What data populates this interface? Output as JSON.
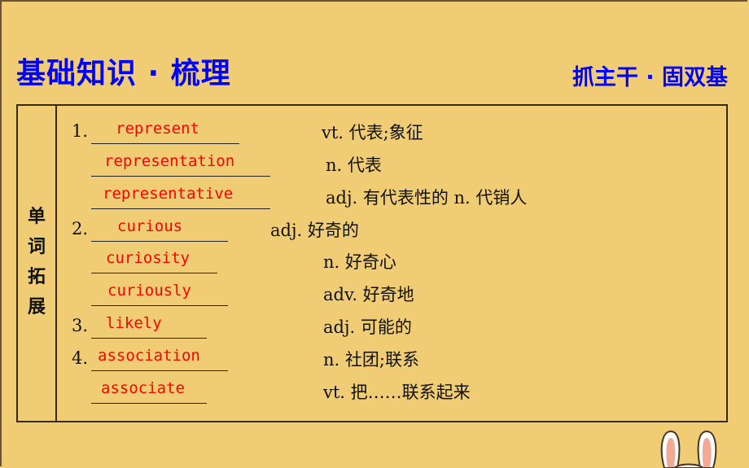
{
  "header": {
    "title": "基础知识 · 梳理",
    "subtitle": "抓主干 · 固双基"
  },
  "section_label": [
    "单",
    "词",
    "拓",
    "展"
  ],
  "items": [
    {
      "number": "1.",
      "answer": "represent",
      "meaning": "vt. 代表;象征"
    },
    {
      "number": "",
      "answer": "representation",
      "meaning": "n. 代表"
    },
    {
      "number": "",
      "answer": "representative",
      "meaning": "adj. 有代表性的  n. 代销人"
    },
    {
      "number": "2.",
      "answer": "curious",
      "meaning": "adj. 好奇的"
    },
    {
      "number": "",
      "answer": "curiosity",
      "meaning": "n. 好奇心"
    },
    {
      "number": "",
      "answer": "curiously",
      "meaning": "adv. 好奇地"
    },
    {
      "number": "3.",
      "answer": "likely",
      "meaning": "adj. 可能的"
    },
    {
      "number": "4.",
      "answer": "association",
      "meaning": "n. 社团;联系"
    },
    {
      "number": "",
      "answer": "associate",
      "meaning": "vt. 把……联系起来"
    }
  ],
  "colors": {
    "background": "#f0cd74",
    "title": "#0000ff",
    "answer": "#ff0000",
    "text": "#111111"
  }
}
